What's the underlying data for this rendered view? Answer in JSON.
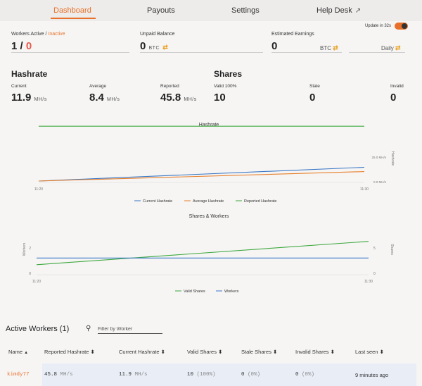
{
  "nav": {
    "tabs": [
      {
        "label": "Dashboard",
        "active": true
      },
      {
        "label": "Payouts"
      },
      {
        "label": "Settings"
      },
      {
        "label": "Help Desk",
        "icon": "external-link-icon"
      }
    ]
  },
  "update": {
    "label": "Update in 32s",
    "enabled": true
  },
  "stats": {
    "workers_label": "Workers Active / ",
    "workers_inactive_label": "Inactive",
    "workers_active": "1",
    "workers_sep": " / ",
    "workers_inactive": "0",
    "unpaid_label": "Unpaid Balance",
    "unpaid_value": "0",
    "unpaid_unit": "BTC",
    "earnings_label": "Estimated Earnings",
    "earnings_value": "0",
    "earnings_unit": "BTC",
    "earnings_period": "Daily",
    "swap_glyph": "⇄"
  },
  "hashrate": {
    "title": "Hashrate",
    "current_label": "Current",
    "current_value": "11.9",
    "average_label": "Average",
    "average_value": "8.4",
    "reported_label": "Reported",
    "reported_value": "45.8",
    "unit": "MH/s"
  },
  "shares": {
    "title": "Shares",
    "valid_label": "Valid 100%",
    "valid_value": "10",
    "stale_label": "Stale",
    "stale_value": "0",
    "invalid_label": "Invalid",
    "invalid_value": "0"
  },
  "chart_data": [
    {
      "type": "line",
      "title": "Hashrate",
      "x": [
        "11:20",
        "11:30"
      ],
      "y2label": "Hashrate",
      "y2ticks": [
        "0.0 MH/s",
        "25.0 MH/s"
      ],
      "ylim": [
        0,
        50
      ],
      "series": [
        {
          "name": "Current Hashrate",
          "color": "#3b78c4",
          "values": [
            0.6,
            11.9
          ]
        },
        {
          "name": "Average Hashrate",
          "color": "#e8802c",
          "values": [
            0.6,
            8.4
          ]
        },
        {
          "name": "Reported Hashrate",
          "color": "#3ea83e",
          "values": [
            45.8,
            45.8
          ]
        }
      ]
    },
    {
      "type": "line",
      "title": "Shares & Workers",
      "x": [
        "11:20",
        "11:30"
      ],
      "ylabel": "Workers",
      "yticks": [
        "0",
        "2"
      ],
      "ylim": [
        0,
        3
      ],
      "y2label": "Shares",
      "y2ticks": [
        "0",
        "5"
      ],
      "y2lim": [
        0,
        15
      ],
      "series": [
        {
          "name": "Valid Shares",
          "color": "#3ea83e",
          "axis": "right",
          "values": [
            3,
            10
          ]
        },
        {
          "name": "Workers",
          "color": "#3b78c4",
          "axis": "left",
          "values": [
            1,
            1
          ]
        }
      ]
    }
  ],
  "workers": {
    "title": "Active Workers (1)",
    "filter_placeholder": "Filter by Worker",
    "columns": [
      {
        "label": "Name",
        "sort": "▲"
      },
      {
        "label": "Reported Hashrate",
        "sort": "⬍"
      },
      {
        "label": "Current Hashrate",
        "sort": "⬍"
      },
      {
        "label": "Valid Shares",
        "sort": "⬍"
      },
      {
        "label": "Stale Shares",
        "sort": "⬍"
      },
      {
        "label": "Invalid Shares",
        "sort": "⬍"
      },
      {
        "label": "Last seen",
        "sort": "⬍"
      }
    ],
    "rows": [
      {
        "name": "kimdy77",
        "reported": "45.8",
        "reported_unit": "MH/s",
        "current": "11.9",
        "current_unit": "MH/s",
        "valid": "10",
        "valid_pct": "(100%)",
        "stale": "0",
        "stale_pct": "(0%)",
        "invalid": "0",
        "invalid_pct": "(0%)",
        "last_seen": "9 minutes ago"
      }
    ]
  }
}
